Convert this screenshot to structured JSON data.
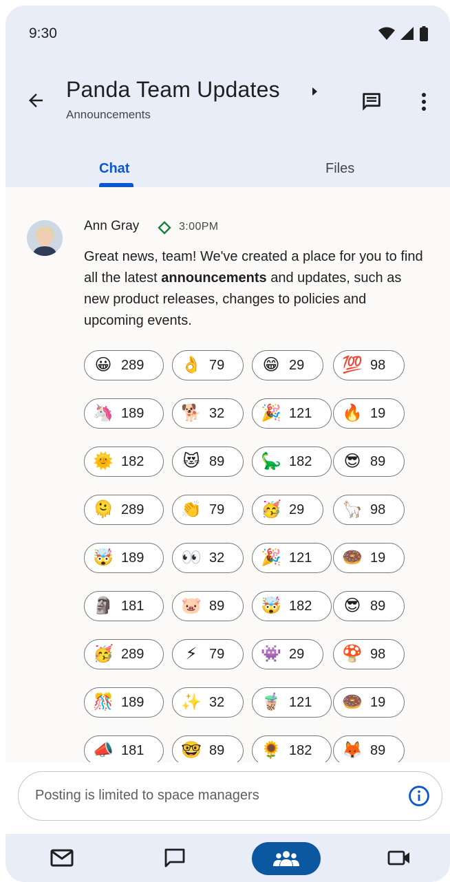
{
  "status_bar": {
    "time": "9:30"
  },
  "header": {
    "title": "Panda Team Updates",
    "subtitle": "Announcements"
  },
  "tabs": [
    {
      "label": "Chat",
      "selected": true
    },
    {
      "label": "Files",
      "selected": false
    }
  ],
  "message": {
    "sender": "Ann Gray",
    "time": "3:00PM",
    "text_before": "Great news, team! We've created a place for you to find all the latest ",
    "text_bold": "announcements",
    "text_after": " and updates, such as new product releases, changes to policies and upcoming events."
  },
  "reactions": [
    {
      "emoji": "😀",
      "icon": "grinning-face-icon",
      "count": "289"
    },
    {
      "emoji": "👌",
      "icon": "ok-hand-icon",
      "count": "79"
    },
    {
      "emoji": "😁",
      "icon": "beaming-face-icon",
      "count": "29"
    },
    {
      "emoji": "💯",
      "icon": "hundred-points-icon",
      "count": "98"
    },
    {
      "emoji": "🦄",
      "icon": "unicorn-icon",
      "count": "189"
    },
    {
      "emoji": "🐕",
      "icon": "doge-icon",
      "count": "32"
    },
    {
      "emoji": "🎉",
      "icon": "party-popper-icon",
      "count": "121"
    },
    {
      "emoji": "🔥",
      "icon": "fire-icon",
      "count": "19"
    },
    {
      "emoji": "🌞",
      "icon": "sun-face-icon",
      "count": "182"
    },
    {
      "emoji": "😻",
      "icon": "heart-eyes-cat-icon",
      "count": "89"
    },
    {
      "emoji": "🦕",
      "icon": "dinosaur-icon",
      "count": "182"
    },
    {
      "emoji": "😎",
      "icon": "sunglasses-face-icon",
      "count": "89"
    },
    {
      "emoji": "🫠",
      "icon": "melting-face-icon",
      "count": "289"
    },
    {
      "emoji": "👏",
      "icon": "clapping-hands-icon",
      "count": "79"
    },
    {
      "emoji": "🥳",
      "icon": "party-hat-icon",
      "count": "29"
    },
    {
      "emoji": "🦙",
      "icon": "llama-icon",
      "count": "98"
    },
    {
      "emoji": "🤯",
      "icon": "exploding-head-icon",
      "count": "189"
    },
    {
      "emoji": "👀",
      "icon": "eyes-icon",
      "count": "32"
    },
    {
      "emoji": "🎉",
      "icon": "party-popper-icon",
      "count": "121"
    },
    {
      "emoji": "🍩",
      "icon": "donut-icon",
      "count": "19"
    },
    {
      "emoji": "🗿",
      "icon": "custom-figure-icon",
      "count": "181"
    },
    {
      "emoji": "🐷",
      "icon": "pig-face-icon",
      "count": "89"
    },
    {
      "emoji": "🤯",
      "icon": "exploding-head-icon",
      "count": "182"
    },
    {
      "emoji": "😎",
      "icon": "sunglasses-face-icon",
      "count": "89"
    },
    {
      "emoji": "🥳",
      "icon": "partying-face-icon",
      "count": "289"
    },
    {
      "emoji": "⚡",
      "icon": "lightning-icon",
      "count": "79"
    },
    {
      "emoji": "👾",
      "icon": "crewmate-icon",
      "count": "29"
    },
    {
      "emoji": "🍄",
      "icon": "mushroom-icon",
      "count": "98"
    },
    {
      "emoji": "🎊",
      "icon": "confetti-ball-icon",
      "count": "189"
    },
    {
      "emoji": "✨",
      "icon": "sparkles-icon",
      "count": "32"
    },
    {
      "emoji": "🧋",
      "icon": "bubble-tea-icon",
      "count": "121"
    },
    {
      "emoji": "🍩",
      "icon": "donut-icon",
      "count": "19"
    },
    {
      "emoji": "📣",
      "icon": "megaphone-icon",
      "count": "181"
    },
    {
      "emoji": "🤓",
      "icon": "nerd-face-icon",
      "count": "89"
    },
    {
      "emoji": "🌻",
      "icon": "sunflower-icon",
      "count": "182"
    },
    {
      "emoji": "🦊",
      "icon": "corgi-icon",
      "count": "89"
    }
  ],
  "composer": {
    "placeholder": "Posting is limited to space managers"
  },
  "bottom_nav": [
    {
      "icon": "mail-icon"
    },
    {
      "icon": "chat-icon"
    },
    {
      "icon": "spaces-icon",
      "selected": true
    },
    {
      "icon": "meet-video-icon"
    }
  ],
  "colors": {
    "accent": "#0b57d0",
    "header_bg": "#e8edf8",
    "nav_selected": "#0b57a0",
    "verified": "#188038"
  }
}
